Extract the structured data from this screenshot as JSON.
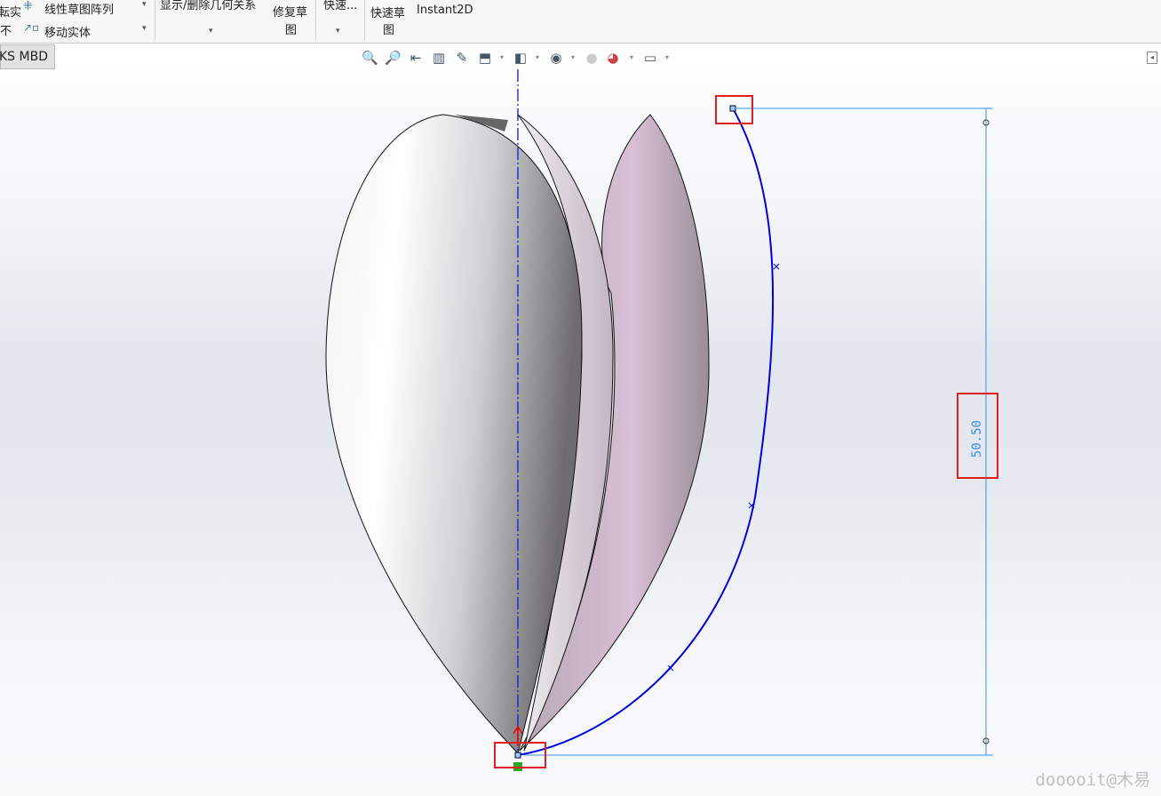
{
  "ribbon": {
    "partial_left_top": "転实",
    "partial_left_bottom": "不",
    "linear_pattern": "线性草图阵列",
    "move_entities": "移动实体",
    "display_relations": "显示/删除几何关系",
    "repair_sketch_1": "修复草",
    "repair_sketch_2": "图",
    "quick_snaps": "快速...",
    "rapid_sketch_1": "快速草",
    "rapid_sketch_2": "图",
    "instant2d": "Instant2D"
  },
  "tabs": {
    "mbd": "KS MBD"
  },
  "view_toolbar": [
    "zoom-to-fit-icon",
    "zoom-to-area-icon",
    "previous-view-icon",
    "section-view-icon",
    "dynamic-annotation-icon",
    "view-orientation-icon",
    "display-style-icon",
    "hide-show-icon",
    "edit-appearance-icon",
    "apply-scene-icon",
    "view-settings-icon"
  ],
  "sketch": {
    "dimension": "50.50",
    "curve_color": "#0000e0",
    "dimension_color": "#3a8fe0",
    "highlight_color": "#e02020"
  },
  "watermark": "dooooit@木易"
}
